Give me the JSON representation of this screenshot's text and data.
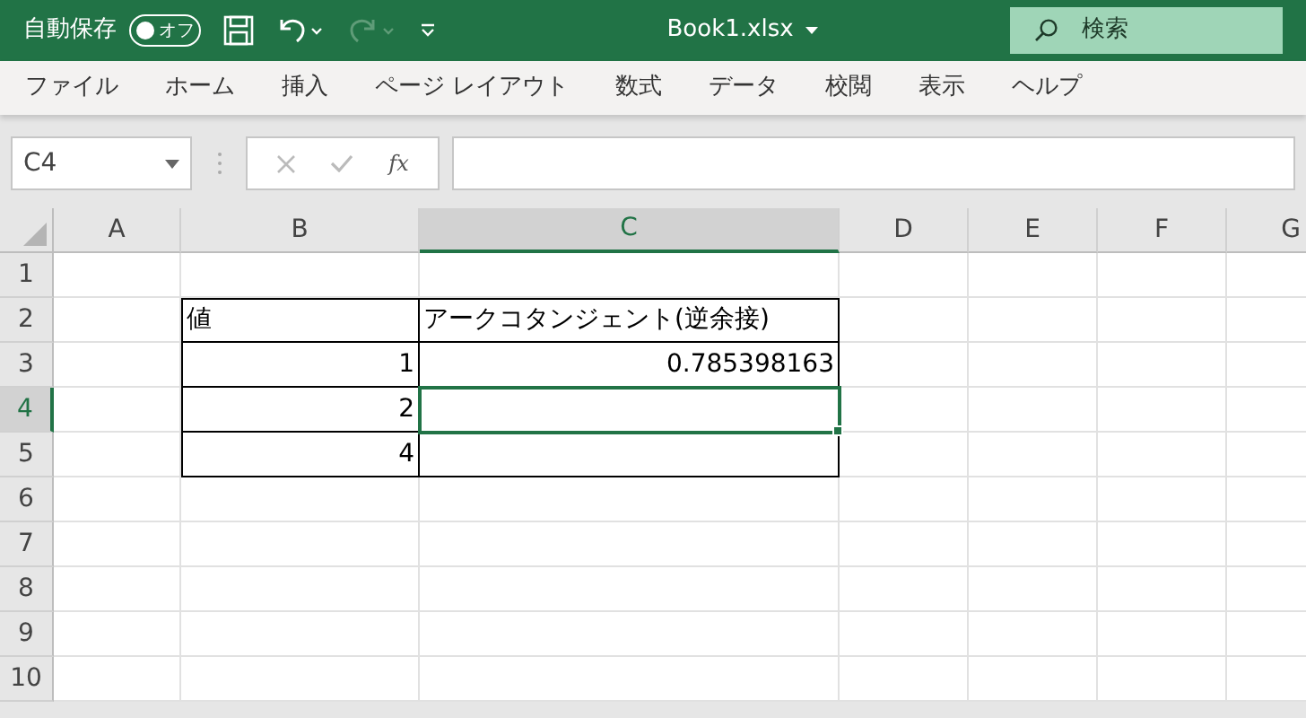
{
  "title_bar": {
    "autosave_label": "自動保存",
    "autosave_state": "オフ",
    "autosave_on": false,
    "redo_disabled": true,
    "filename": "Book1.xlsx",
    "search_placeholder": "検索"
  },
  "menu": [
    {
      "label": "ファイル"
    },
    {
      "label": "ホーム"
    },
    {
      "label": "挿入"
    },
    {
      "label": "ページ レイアウト"
    },
    {
      "label": "数式"
    },
    {
      "label": "データ"
    },
    {
      "label": "校閲"
    },
    {
      "label": "表示"
    },
    {
      "label": "ヘルプ"
    }
  ],
  "formula_bar": {
    "name_box": "C4",
    "fx": "fx"
  },
  "columns": [
    {
      "label": "A",
      "selected": false
    },
    {
      "label": "B",
      "selected": false
    },
    {
      "label": "C",
      "selected": true
    },
    {
      "label": "D",
      "selected": false
    },
    {
      "label": "E",
      "selected": false
    },
    {
      "label": "F",
      "selected": false
    },
    {
      "label": "G",
      "selected": false
    }
  ],
  "rows": [
    {
      "header": "1",
      "selected": false,
      "cells": [
        {
          "bordered": false,
          "selected": false
        },
        {
          "bordered": false,
          "selected": false
        },
        {
          "bordered": false,
          "selected": false
        },
        {
          "bordered": false,
          "selected": false
        },
        {
          "bordered": false,
          "selected": false
        },
        {
          "bordered": false,
          "selected": false
        },
        {
          "bordered": false,
          "selected": false
        }
      ]
    },
    {
      "header": "2",
      "selected": false,
      "cells": [
        {
          "bordered": false,
          "selected": false
        },
        {
          "text": "値",
          "kind": "text",
          "bordered": true,
          "selected": false
        },
        {
          "text": "アークコタンジェント(逆余接)",
          "kind": "text",
          "bordered": true,
          "selected": false
        },
        {
          "bordered": false,
          "selected": false
        },
        {
          "bordered": false,
          "selected": false
        },
        {
          "bordered": false,
          "selected": false
        },
        {
          "bordered": false,
          "selected": false
        }
      ]
    },
    {
      "header": "3",
      "selected": false,
      "cells": [
        {
          "bordered": false,
          "selected": false
        },
        {
          "text": "1",
          "kind": "number",
          "bordered": true,
          "selected": false
        },
        {
          "text": "0.785398163",
          "kind": "number",
          "bordered": true,
          "selected": false
        },
        {
          "bordered": false,
          "selected": false
        },
        {
          "bordered": false,
          "selected": false
        },
        {
          "bordered": false,
          "selected": false
        },
        {
          "bordered": false,
          "selected": false
        }
      ]
    },
    {
      "header": "4",
      "selected": true,
      "cells": [
        {
          "bordered": false,
          "selected": false
        },
        {
          "text": "2",
          "kind": "number",
          "bordered": true,
          "selected": false
        },
        {
          "bordered": true,
          "selected": true
        },
        {
          "bordered": false,
          "selected": false
        },
        {
          "bordered": false,
          "selected": false
        },
        {
          "bordered": false,
          "selected": false
        },
        {
          "bordered": false,
          "selected": false
        }
      ]
    },
    {
      "header": "5",
      "selected": false,
      "cells": [
        {
          "bordered": false,
          "selected": false
        },
        {
          "text": "4",
          "kind": "number",
          "bordered": true,
          "selected": false
        },
        {
          "bordered": true,
          "selected": false
        },
        {
          "bordered": false,
          "selected": false
        },
        {
          "bordered": false,
          "selected": false
        },
        {
          "bordered": false,
          "selected": false
        },
        {
          "bordered": false,
          "selected": false
        }
      ]
    },
    {
      "header": "6",
      "selected": false,
      "cells": [
        {
          "bordered": false,
          "selected": false
        },
        {
          "bordered": false,
          "selected": false
        },
        {
          "bordered": false,
          "selected": false
        },
        {
          "bordered": false,
          "selected": false
        },
        {
          "bordered": false,
          "selected": false
        },
        {
          "bordered": false,
          "selected": false
        },
        {
          "bordered": false,
          "selected": false
        }
      ]
    },
    {
      "header": "7",
      "selected": false,
      "cells": [
        {
          "bordered": false,
          "selected": false
        },
        {
          "bordered": false,
          "selected": false
        },
        {
          "bordered": false,
          "selected": false
        },
        {
          "bordered": false,
          "selected": false
        },
        {
          "bordered": false,
          "selected": false
        },
        {
          "bordered": false,
          "selected": false
        },
        {
          "bordered": false,
          "selected": false
        }
      ]
    },
    {
      "header": "8",
      "selected": false,
      "cells": [
        {
          "bordered": false,
          "selected": false
        },
        {
          "bordered": false,
          "selected": false
        },
        {
          "bordered": false,
          "selected": false
        },
        {
          "bordered": false,
          "selected": false
        },
        {
          "bordered": false,
          "selected": false
        },
        {
          "bordered": false,
          "selected": false
        },
        {
          "bordered": false,
          "selected": false
        }
      ]
    },
    {
      "header": "9",
      "selected": false,
      "cells": [
        {
          "bordered": false,
          "selected": false
        },
        {
          "bordered": false,
          "selected": false
        },
        {
          "bordered": false,
          "selected": false
        },
        {
          "bordered": false,
          "selected": false
        },
        {
          "bordered": false,
          "selected": false
        },
        {
          "bordered": false,
          "selected": false
        },
        {
          "bordered": false,
          "selected": false
        }
      ]
    },
    {
      "header": "10",
      "selected": false,
      "cells": [
        {
          "bordered": false,
          "selected": false
        },
        {
          "bordered": false,
          "selected": false
        },
        {
          "bordered": false,
          "selected": false
        },
        {
          "bordered": false,
          "selected": false
        },
        {
          "bordered": false,
          "selected": false
        },
        {
          "bordered": false,
          "selected": false
        },
        {
          "bordered": false,
          "selected": false
        }
      ]
    }
  ]
}
